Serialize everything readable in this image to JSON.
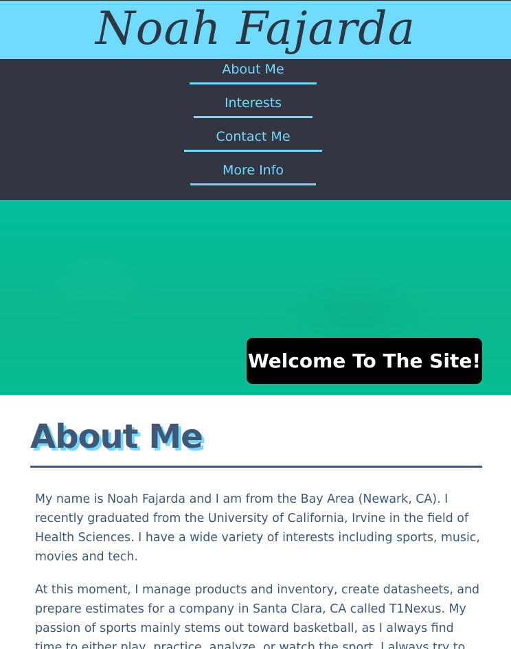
{
  "header": {
    "title": "Noah Fajarda"
  },
  "nav": {
    "items": [
      {
        "label": "About Me"
      },
      {
        "label": "Interests"
      },
      {
        "label": "Contact Me"
      },
      {
        "label": "More Info"
      }
    ]
  },
  "hero": {
    "banner_text": "Welcome To The Site!"
  },
  "about": {
    "heading": "About Me",
    "paragraphs": [
      "My name is Noah Fajarda and I am from the Bay Area (Newark, CA). I recently graduated from the University of California, Irvine in the field of Health Sciences. I have a wide variety of interests including sports, music, movies and tech.",
      "At this moment, I manage products and inventory, create datasheets, and prepare estimates for a company in Santa Clara, CA called T1Nexus. My passion of sports mainly stems out toward basketball, as I always find time to either play, practice, analyze, or watch the sport. I always try to find"
    ]
  },
  "colors": {
    "header_bg": "#6fdbff",
    "nav_bg": "#333641",
    "accent": "#6fdbff",
    "hero_bg": "#02bf9b",
    "heading_text": "#3f5878",
    "body_text": "#3a5a7c",
    "banner_bg": "#000000"
  }
}
